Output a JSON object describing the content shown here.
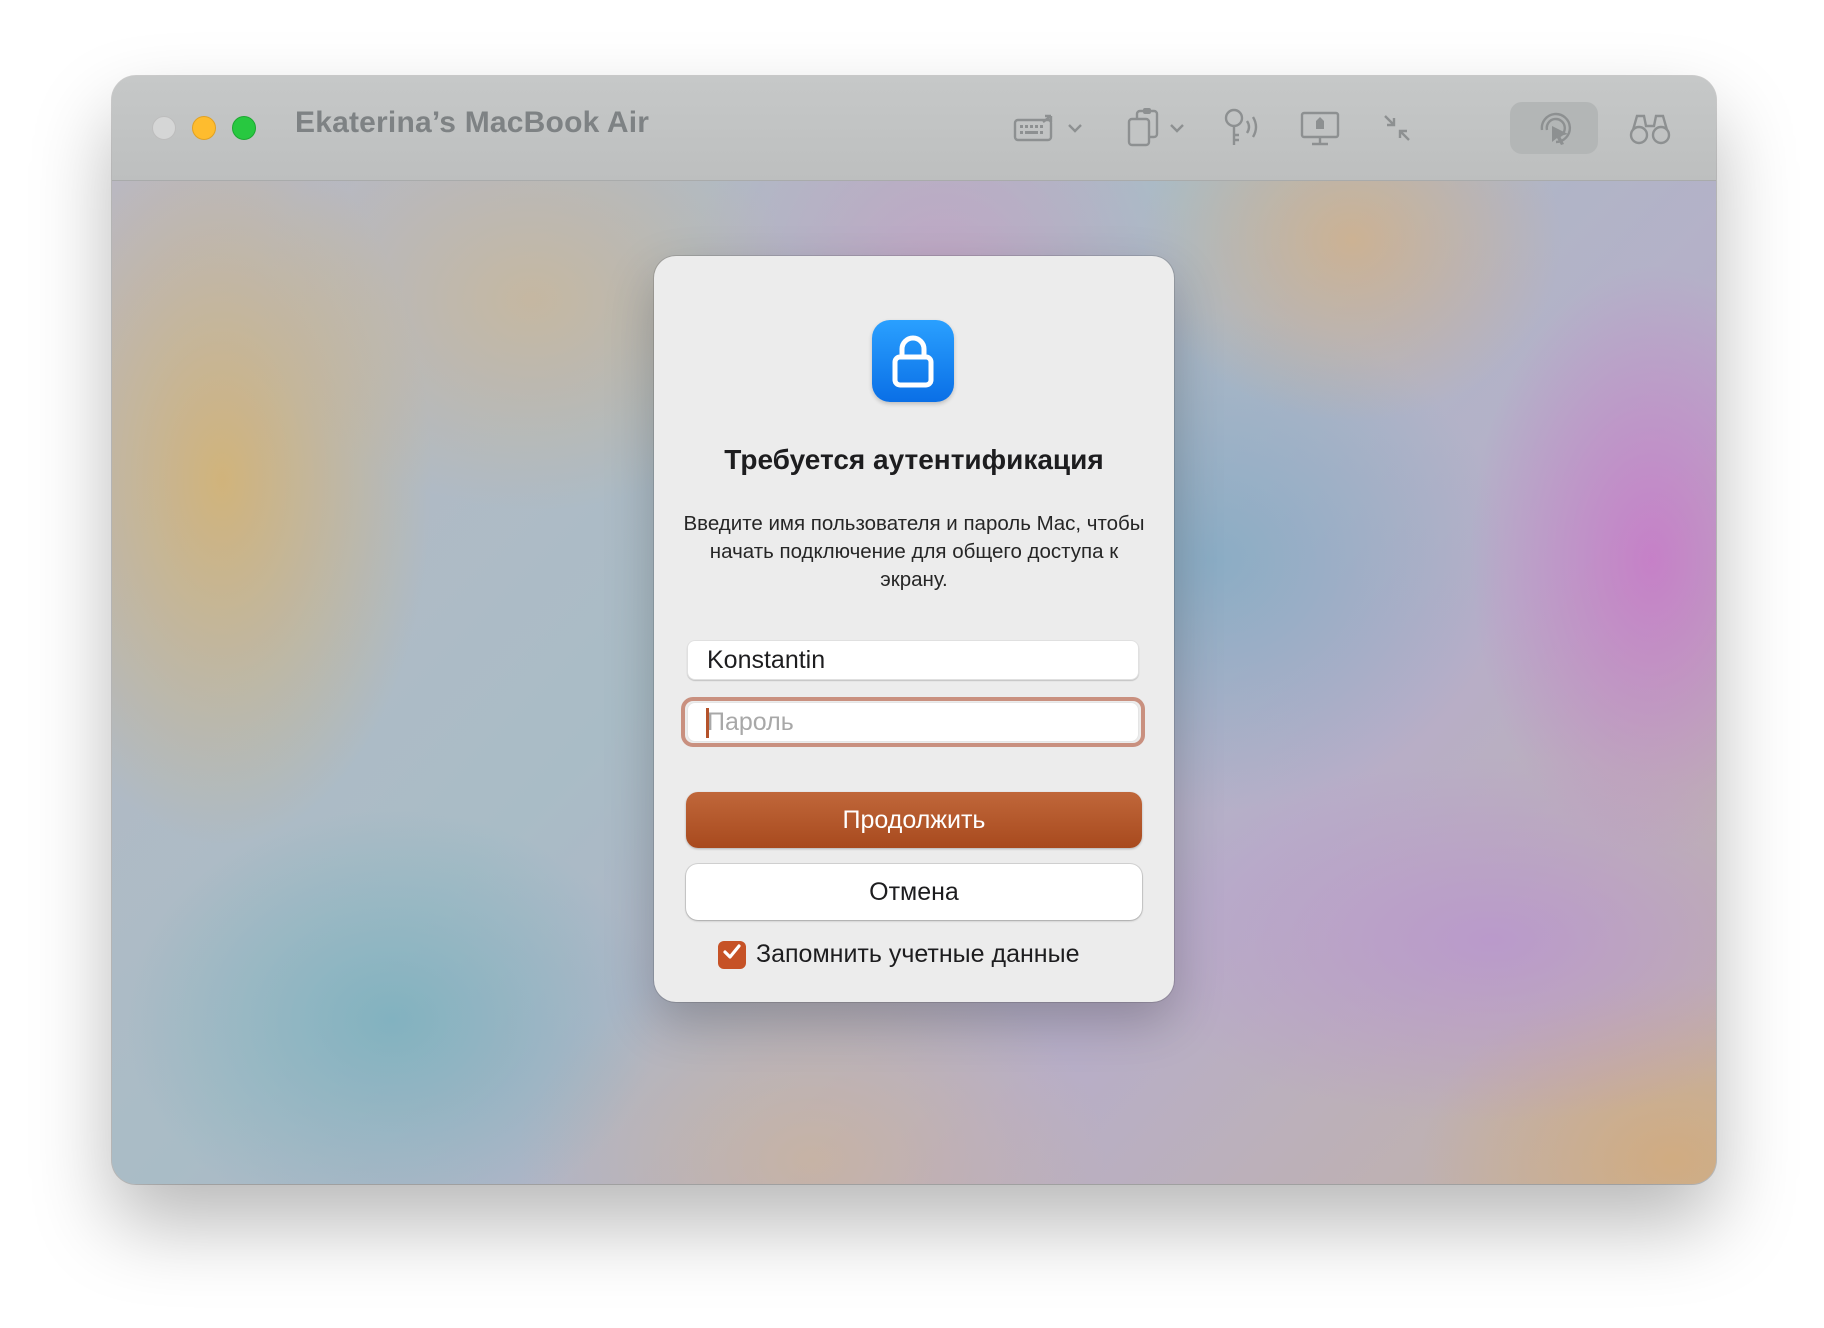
{
  "window": {
    "title": "Ekaterina’s MacBook Air"
  },
  "toolbar": {
    "icons": [
      "keyboard-send-icon",
      "clipboard-icon",
      "voice-control-icon",
      "display-icon",
      "scale-icon",
      "pointer-share-icon",
      "binoculars-icon"
    ],
    "active_icon": "pointer-share-icon"
  },
  "dialog": {
    "title": "Требуется аутентификация",
    "message": "Введите имя пользователя и пароль Mac, чтобы начать подключение для общего доступа к экрану.",
    "username_value": "Konstantin",
    "password_placeholder": "Пароль",
    "continue_label": "Продолжить",
    "cancel_label": "Отмена",
    "remember_label": "Запомнить учетные данные",
    "remember_checked": true
  },
  "colors": {
    "accent": "#b4522a",
    "lock_icon": "#1a87f2",
    "traffic_minimize": "#febc2e",
    "traffic_zoom": "#28c840"
  }
}
